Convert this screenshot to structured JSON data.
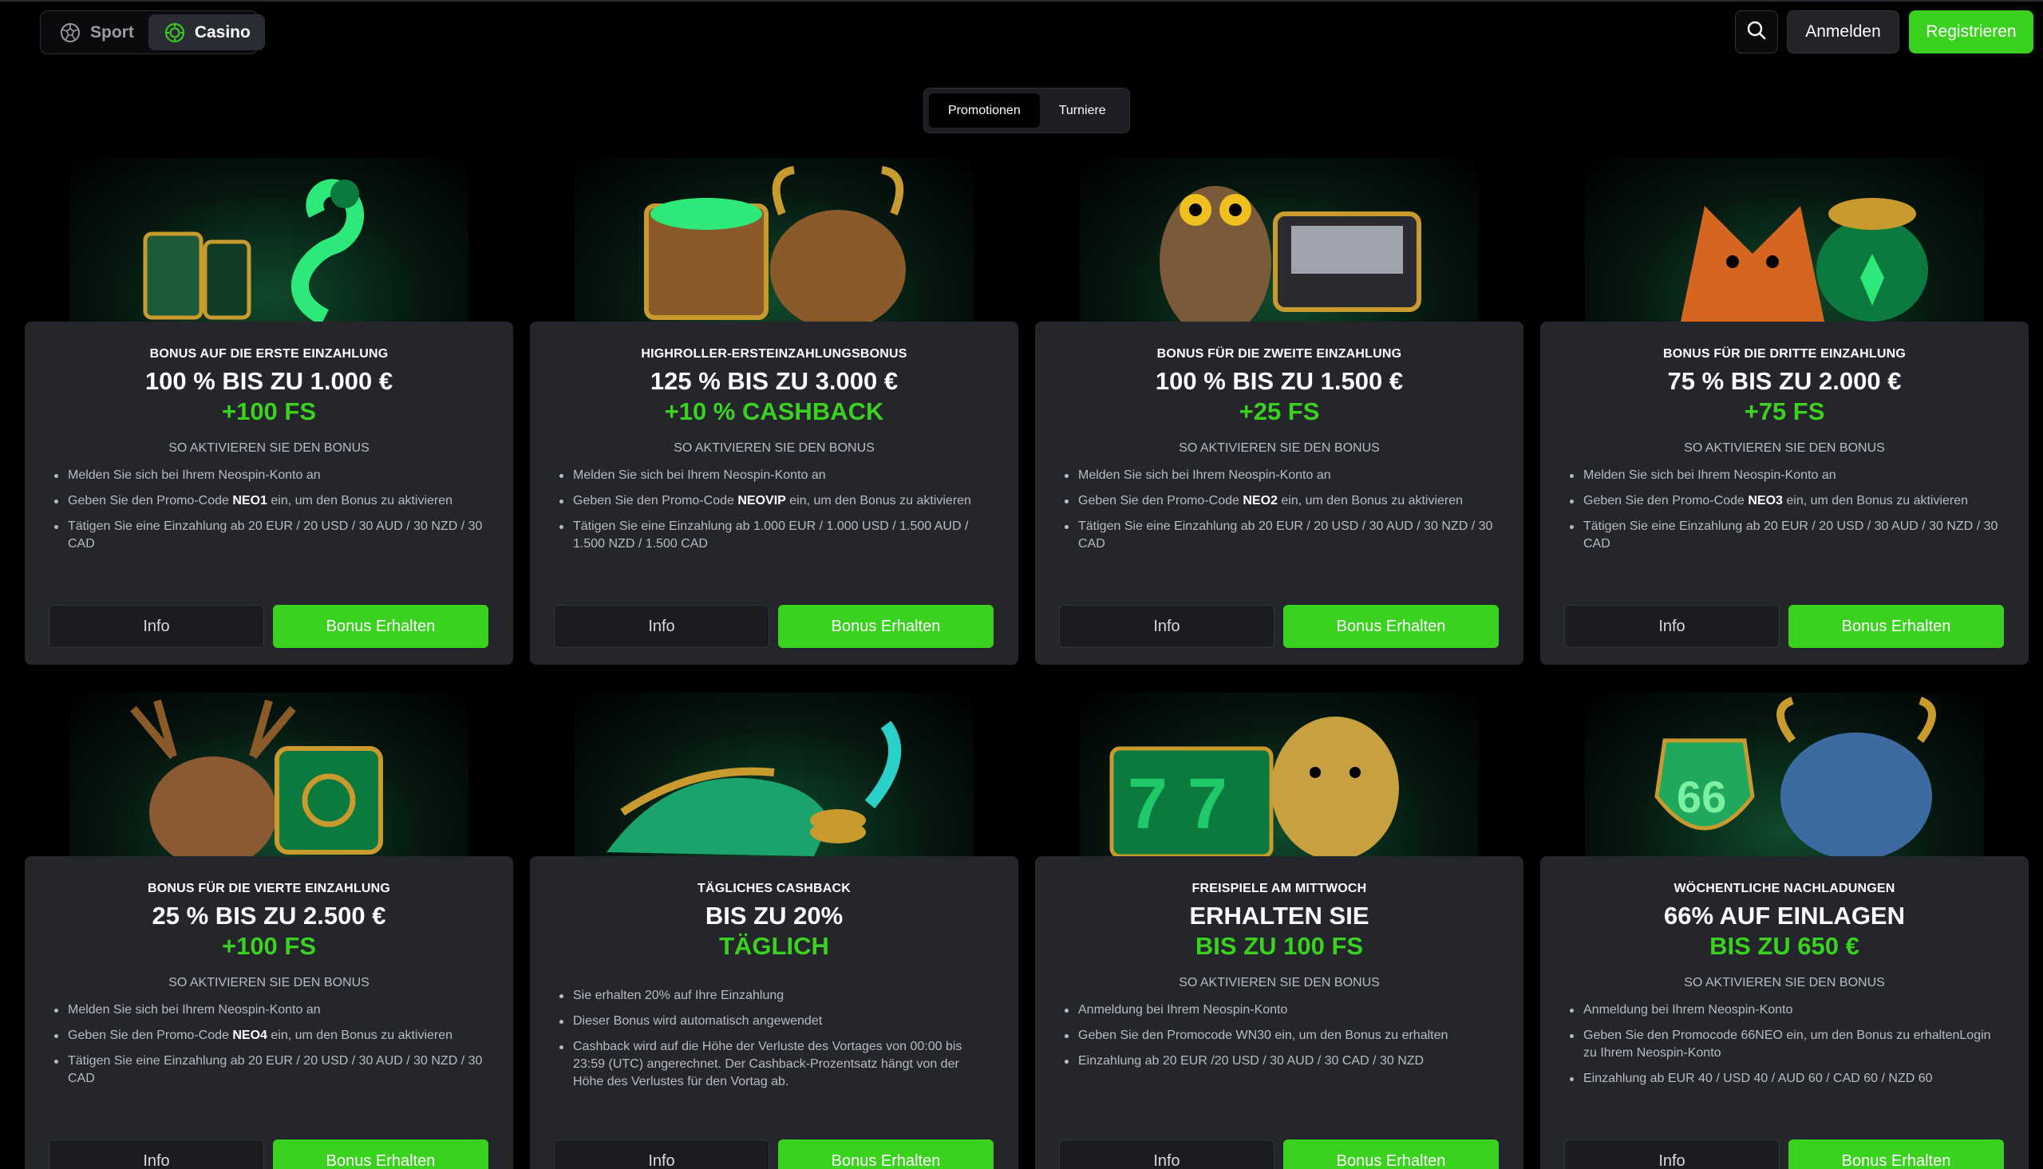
{
  "header": {
    "switcher": [
      {
        "label": "Sport",
        "icon": "soccer-ball-icon",
        "active": false
      },
      {
        "label": "Casino",
        "icon": "casino-chip-icon",
        "active": true
      }
    ],
    "search_icon": "search-icon",
    "login_label": "Anmelden",
    "register_label": "Registrieren"
  },
  "tabs": [
    {
      "label": "Promotionen",
      "active": true
    },
    {
      "label": "Turniere",
      "active": false
    }
  ],
  "colors": {
    "accent": "#3ad11f",
    "panel": "#25262c",
    "background": "#000000"
  },
  "cards": [
    {
      "kicker": "BONUS AUF DIE ERSTE EINZAHLUNG",
      "headline": "100 % BIS ZU 1.000 €",
      "accent": "+100 FS",
      "howto": "SO AKTIVIEREN SIE DEN BONUS",
      "bullets": [
        "Melden Sie sich bei Ihrem Neospin-Konto an",
        "Geben Sie den Promo-Code NEO1 ein, um den Bonus zu aktivieren",
        "Tätigen Sie eine Einzahlung ab 20 EUR / 20 USD / 30 AUD / 30 NZD / 30 CAD"
      ],
      "info_label": "Info",
      "bonus_label": "Bonus Erhalten",
      "art": "snake-slot-illustration"
    },
    {
      "kicker": "HIGHROLLER-ERSTEINZAHLUNGSBONUS",
      "headline": "125 % BIS ZU 3.000 €",
      "accent": "+10 % CASHBACK",
      "howto": "SO AKTIVIEREN SIE DEN BONUS",
      "bullets": [
        "Melden Sie sich bei Ihrem Neospin-Konto an",
        "Geben Sie den Promo-Code NEOVIP ein, um den Bonus zu aktivieren",
        "Tätigen Sie eine Einzahlung ab 1.000 EUR / 1.000 USD / 1.500 AUD / 1.500 NZD / 1.500 CAD"
      ],
      "info_label": "Info",
      "bonus_label": "Bonus Erhalten",
      "art": "bull-treasure-illustration"
    },
    {
      "kicker": "BONUS FÜR DIE ZWEITE EINZAHLUNG",
      "headline": "100 % BIS ZU 1.500 €",
      "accent": "+25 FS",
      "howto": "SO AKTIVIEREN SIE DEN BONUS",
      "bullets": [
        "Melden Sie sich bei Ihrem Neospin-Konto an",
        "Geben Sie den Promo-Code NEO2 ein, um den Bonus zu aktivieren",
        "Tätigen Sie eine Einzahlung ab 20 EUR / 20 USD / 30 AUD / 30 NZD / 30 CAD"
      ],
      "info_label": "Info",
      "bonus_label": "Bonus Erhalten",
      "art": "owl-suitcase-illustration"
    },
    {
      "kicker": "BONUS FÜR DIE DRITTE EINZAHLUNG",
      "headline": "75 % BIS ZU 2.000 €",
      "accent": "+75 FS",
      "howto": "SO AKTIVIEREN SIE DEN BONUS",
      "bullets": [
        "Melden Sie sich bei Ihrem Neospin-Konto an",
        "Geben Sie den Promo-Code NEO3 ein, um den Bonus zu aktivieren",
        "Tätigen Sie eine Einzahlung ab 20 EUR / 20 USD / 30 AUD / 30 NZD / 30 CAD"
      ],
      "info_label": "Info",
      "bonus_label": "Bonus Erhalten",
      "art": "fox-coins-illustration"
    },
    {
      "kicker": "BONUS FÜR DIE VIERTE EINZAHLUNG",
      "headline": "25 % BIS ZU 2.500 €",
      "accent": "+100 FS",
      "howto": "SO AKTIVIEREN SIE DEN BONUS",
      "bullets": [
        "Melden Sie sich bei Ihrem Neospin-Konto an",
        "Geben Sie den Promo-Code NEO4 ein, um den Bonus zu aktivieren",
        "Tätigen Sie eine Einzahlung ab 20 EUR / 20 USD / 30 AUD / 30 NZD / 30 CAD"
      ],
      "info_label": "Info",
      "bonus_label": "Bonus Erhalten",
      "art": "deer-safe-illustration"
    },
    {
      "kicker": "TÄGLICHES CASHBACK",
      "headline": "BIS ZU 20%",
      "accent": "TÄGLICH",
      "howto": "",
      "bullets": [
        "Sie erhalten 20% auf Ihre Einzahlung",
        "Dieser Bonus wird automatisch angewendet",
        "Cashback wird auf die Höhe der Verluste des Vortages von 00:00 bis 23:59 (UTC) angerechnet. Der Cashback-Prozentsatz hängt von der Höhe des Verlustes für den Vortag ab."
      ],
      "info_label": "Info",
      "bonus_label": "Bonus Erhalten",
      "art": "crocodile-coins-illustration"
    },
    {
      "kicker": "FREISPIELE AM MITTWOCH",
      "headline": "ERHALTEN SIE",
      "accent": "BIS ZU 100 FS",
      "howto": "SO AKTIVIEREN SIE DEN BONUS",
      "bullets": [
        "Anmeldung bei Ihrem Neospin-Konto",
        "Geben Sie den Promocode WN30 ein, um den Bonus zu erhalten",
        "Einzahlung ab 20 EUR /20 USD / 30 AUD / 30 CAD / 30 NZD"
      ],
      "info_label": "Info",
      "bonus_label": "Bonus Erhalten",
      "art": "leopard-777-illustration"
    },
    {
      "kicker": "WÖCHENTLICHE NACHLADUNGEN",
      "headline": "66% AUF EINLAGEN",
      "accent": "BIS ZU 650 €",
      "howto": "SO AKTIVIEREN SIE DEN BONUS",
      "bullets": [
        "Anmeldung bei Ihrem Neospin-Konto",
        "Geben Sie den Promocode 66NEO ein, um den Bonus zu erhaltenLogin zu Ihrem Neospin-Konto",
        "Einzahlung ab EUR 40 / USD 40 / AUD 60 / CAD 60 / NZD 60"
      ],
      "info_label": "Info",
      "bonus_label": "Bonus Erhalten",
      "art": "bison-route66-illustration"
    }
  ]
}
